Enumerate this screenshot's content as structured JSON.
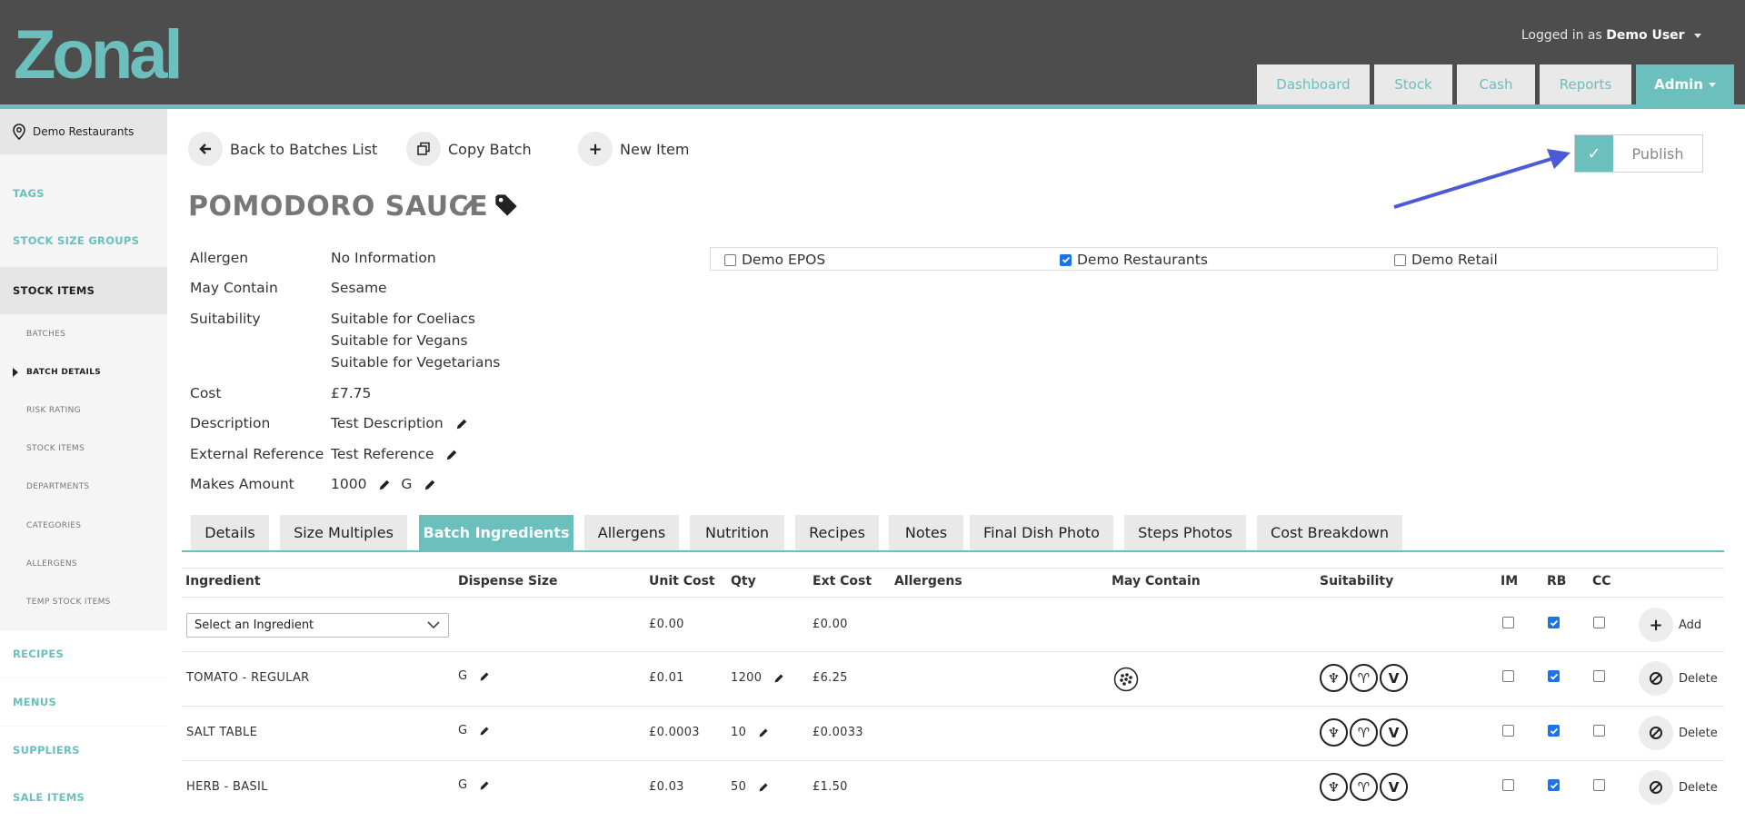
{
  "header": {
    "logo_text": "Zonal",
    "logged_in_prefix": "Logged in as",
    "user": "Demo User",
    "nav": [
      "Dashboard",
      "Stock",
      "Cash",
      "Reports",
      "Admin"
    ]
  },
  "sidebar": {
    "location": "Demo Restaurants",
    "items": [
      "TAGS",
      "STOCK SIZE GROUPS",
      "STOCK ITEMS",
      "RECIPES",
      "MENUS",
      "SUPPLIERS",
      "SALE ITEMS"
    ],
    "sub_items": [
      "BATCHES",
      "BATCH DETAILS",
      "RISK RATING",
      "STOCK ITEMS",
      "DEPARTMENTS",
      "CATEGORIES",
      "ALLERGENS",
      "TEMP STOCK ITEMS"
    ]
  },
  "actions": {
    "back": "Back to Batches List",
    "copy": "Copy Batch",
    "new_item": "New Item",
    "publish": "Publish"
  },
  "batch": {
    "title": "POMODORO SAUCE",
    "labels": {
      "allergen": "Allergen",
      "may_contain": "May Contain",
      "suitability": "Suitability",
      "cost": "Cost",
      "description": "Description",
      "external_reference": "External Reference",
      "makes_amount": "Makes Amount"
    },
    "allergen": "No Information",
    "may_contain": "Sesame",
    "suitability": [
      "Suitable for Coeliacs",
      "Suitable for Vegans",
      "Suitable for Vegetarians"
    ],
    "cost": "£7.75",
    "description": "Test Description",
    "external_reference": "Test Reference",
    "makes_amount": "1000",
    "makes_unit": "G"
  },
  "sites": [
    {
      "label": "Demo EPOS",
      "checked": false
    },
    {
      "label": "Demo Restaurants",
      "checked": true
    },
    {
      "label": "Demo Retail",
      "checked": false
    }
  ],
  "tabs": [
    "Details",
    "Size Multiples",
    "Batch Ingredients",
    "Allergens",
    "Nutrition",
    "Recipes",
    "Notes",
    "Final Dish Photo",
    "Steps Photos",
    "Cost Breakdown"
  ],
  "table": {
    "headers": [
      "Ingredient",
      "Dispense Size",
      "Unit Cost",
      "Qty",
      "Ext Cost",
      "Allergens",
      "May Contain",
      "Suitability",
      "IM",
      "RB",
      "CC"
    ],
    "new_row": {
      "select_placeholder": "Select an Ingredient",
      "unit_cost": "£0.00",
      "ext_cost": "£0.00",
      "add_label": "Add"
    },
    "rows": [
      {
        "ingredient": "TOMATO - REGULAR",
        "dispense": "G",
        "unit_cost": "£0.01",
        "qty": "1200",
        "ext_cost": "£6.25",
        "may_contain_icon": "sesame-icon",
        "delete": "Delete"
      },
      {
        "ingredient": "SALT TABLE",
        "dispense": "G",
        "unit_cost": "£0.0003",
        "qty": "10",
        "ext_cost": "£0.0033",
        "delete": "Delete"
      },
      {
        "ingredient": "HERB - BASIL",
        "dispense": "G",
        "unit_cost": "£0.03",
        "qty": "50",
        "ext_cost": "£1.50",
        "delete": "Delete"
      }
    ],
    "suitability_icons": [
      "coeliac-icon",
      "vegan-icon",
      "vegetarian-icon"
    ]
  },
  "colors": {
    "accent": "#6bbfbc",
    "header_bg": "#4d4d4d",
    "annotation_arrow": "#4b5bd6"
  }
}
